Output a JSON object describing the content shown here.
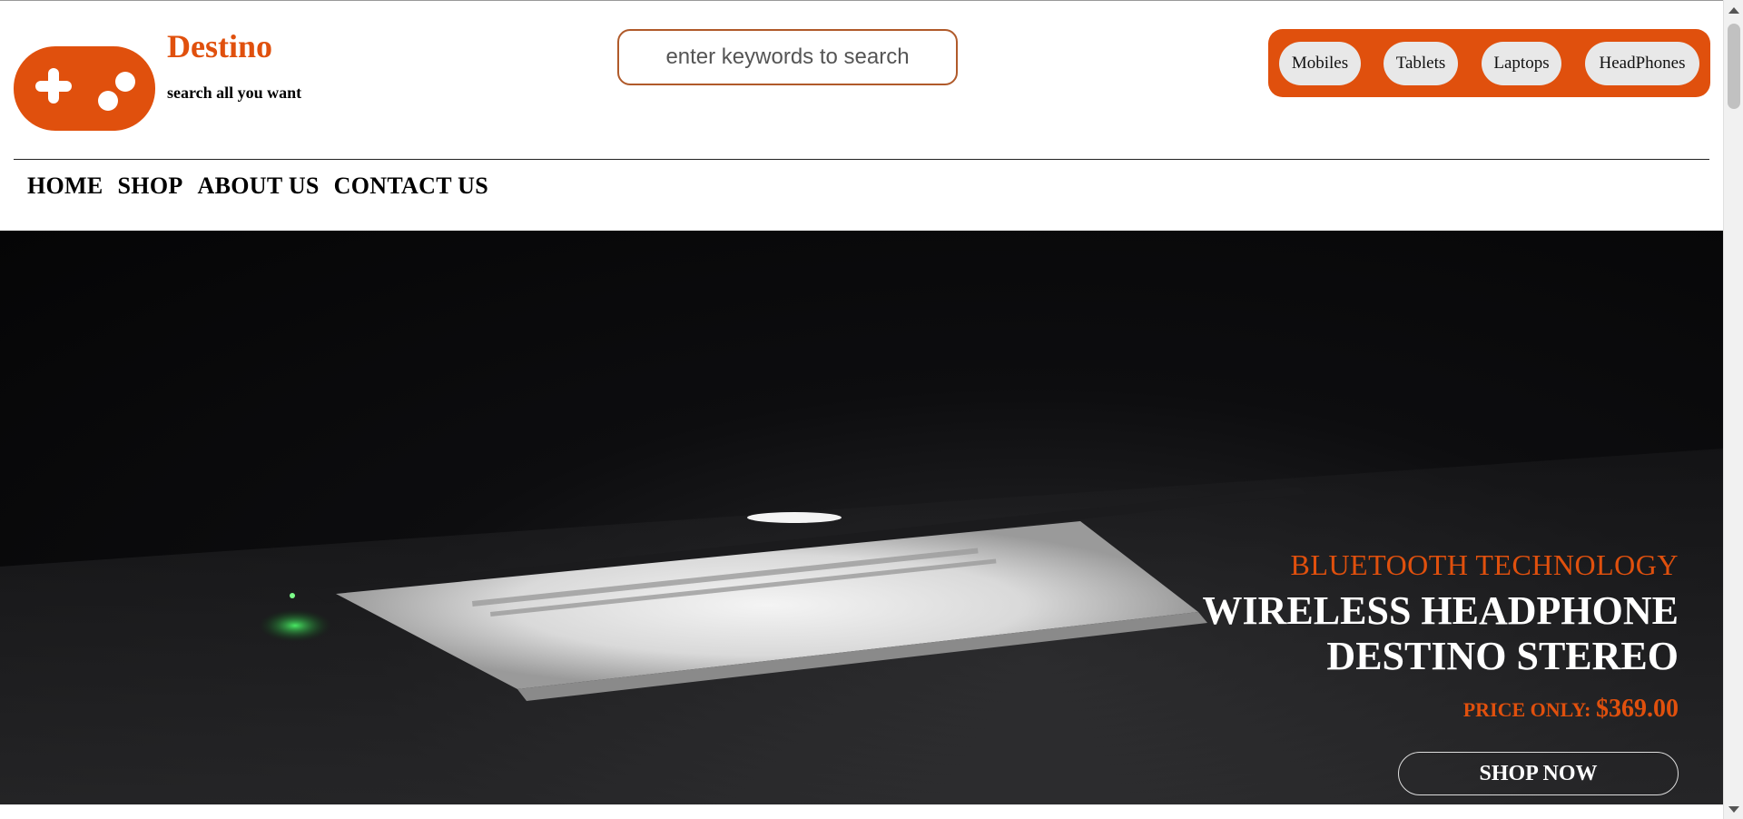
{
  "brand": {
    "name": "Destino",
    "tagline": "search all you want",
    "logo_icon": "gamepad-icon",
    "accent_color": "#e0500d"
  },
  "search": {
    "placeholder": "enter keywords to search",
    "value": ""
  },
  "categories": [
    {
      "label": "Mobiles"
    },
    {
      "label": "Tablets"
    },
    {
      "label": "Laptops"
    },
    {
      "label": "HeadPhones"
    }
  ],
  "nav": [
    {
      "label": "HOME"
    },
    {
      "label": "SHOP"
    },
    {
      "label": "ABOUT US"
    },
    {
      "label": "CONTACT US"
    }
  ],
  "hero": {
    "kicker": "BLUETOOTH TECHNOLOGY",
    "title_line1": "WIRELESS HEADPHONE",
    "title_line2": "DESTINO STEREO",
    "price_label": "PRICE ONLY:",
    "price": "$369.00",
    "cta_label": "SHOP NOW",
    "image": "laptop-in-dark-image"
  }
}
